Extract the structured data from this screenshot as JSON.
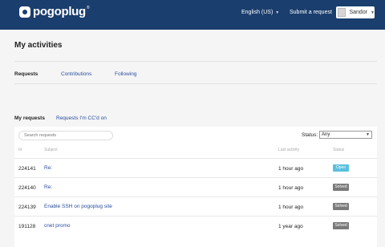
{
  "header": {
    "logo_text": "pogoplug",
    "logo_tm": "®",
    "language": "English (US)",
    "submit_request": "Submit a request",
    "user_name": "Sandor"
  },
  "page": {
    "title": "My activities",
    "subnav": [
      "Requests",
      "Contributions",
      "Following"
    ],
    "tabs": [
      "My requests",
      "Requests I'm CC'd on"
    ]
  },
  "filters": {
    "search_placeholder": "Search requests",
    "status_label": "Status:",
    "status_value": "Any"
  },
  "table": {
    "columns": [
      "Id",
      "Subject",
      "Last activity",
      "Status"
    ],
    "rows": [
      {
        "id": "224141",
        "subject": "Re:",
        "last_activity": "1 hour ago",
        "status": "Open"
      },
      {
        "id": "224140",
        "subject": "Re:",
        "last_activity": "1 hour ago",
        "status": "Solved"
      },
      {
        "id": "224139",
        "subject": "Enable SSH on pogoplug site",
        "last_activity": "1 hour ago",
        "status": "Solved"
      },
      {
        "id": "191128",
        "subject": "cnet promo",
        "last_activity": "1 year ago",
        "status": "Solved"
      }
    ]
  },
  "colors": {
    "header_bg": "#1a3e6d",
    "link": "#2a4d9e",
    "status_open": "#5bc0de",
    "status_solved": "#7a7a7a"
  }
}
